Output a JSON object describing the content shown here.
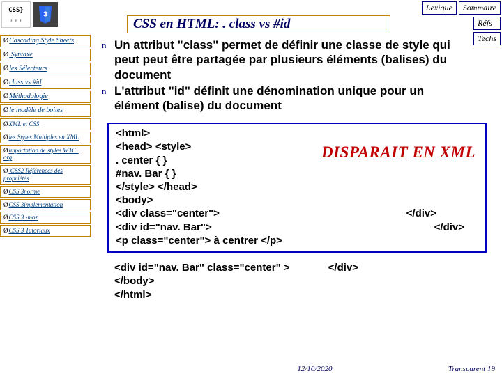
{
  "topbar": {
    "lexique": "Lexique",
    "sommaire": "Sommaire"
  },
  "rightbar": {
    "refs": "Réfs",
    "techs": "Techs"
  },
  "logos": {
    "css_label": "CSS}",
    "css_sub": "‚‚‚"
  },
  "title": "CSS en HTML: . class vs #id",
  "sidebar": {
    "items": [
      "Cascading Style Sheets",
      " Syntaxe",
      "les Sélecteurs",
      "class vs #id",
      "Méthodologie",
      "le modèle de boites",
      "XML et CSS",
      "les Styles Multiples en XML",
      "importation de styles W3C . org",
      " CSS2  Références des propriétés",
      "CSS 3norme",
      "CSS 3implementation",
      "CSS 3 -moz",
      "CSS 3 Tutoriaux"
    ]
  },
  "bullets": [
    "Un attribut \"class\" permet de définir une classe de style qui peut peut être partagée par plusieurs éléments (balises) du document",
    "L'attribut \"id\" définit une dénomination unique pour un élément (balise) du document"
  ],
  "code": {
    "l1": "<html>",
    "l2": "<head> <style>",
    "l3": ". center { }",
    "l4": "#nav. Bar { }",
    "l5": "</style> </head>",
    "l6": "<body>",
    "l7a": "<div class=\"center\">",
    "l7b": "</div>",
    "l8a": "<div id=\"nav. Bar\">",
    "l8b": "</div>",
    "l9": "<p class=\"center\"> à centrer </p>",
    "watermark": "DISPARAIT EN XML"
  },
  "extra": {
    "l1a": "<div id=\"nav. Bar\" class=\"center\" >",
    "l1b": "</div>",
    "l2": "</body>",
    "l3": "</html>"
  },
  "footer": {
    "date": "12/10/2020",
    "page": "Transparent 19"
  }
}
